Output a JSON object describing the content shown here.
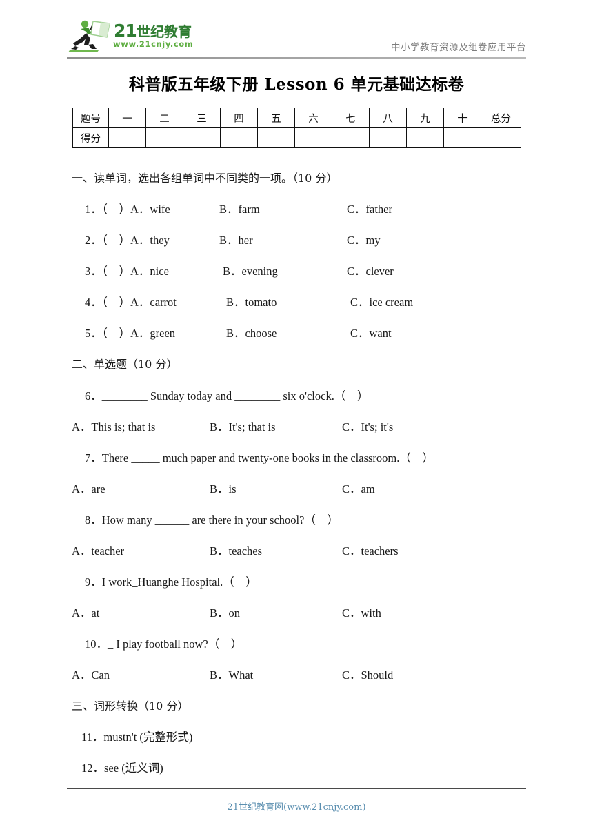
{
  "header": {
    "logo_text_main": "21世纪教育",
    "logo_text_url": "www.21cnjy.com",
    "tagline": "中小学教育资源及组卷应用平台",
    "brand_color": "#2f7d32",
    "tagline_color": "#7d7d7d"
  },
  "title": "科普版五年级下册 Lesson 6 单元基础达标卷",
  "score_table": {
    "row_labels": [
      "题号",
      "得分"
    ],
    "columns": [
      "一",
      "二",
      "三",
      "四",
      "五",
      "六",
      "七",
      "八",
      "九",
      "十",
      "总分"
    ],
    "scores": [
      "",
      "",
      "",
      "",
      "",
      "",
      "",
      "",
      "",
      "",
      ""
    ]
  },
  "sections": [
    {
      "heading": "一、读单词，选出各组单词中不同类的一项。（10 分）",
      "questions": [
        {
          "stem": "1．（　）A．wife",
          "options": [
            "B．farm",
            "C．father"
          ]
        },
        {
          "stem": "2．（　）A．they",
          "options": [
            "B．her",
            "C．my"
          ]
        },
        {
          "stem": "3．（　）A．nice",
          "options": [
            "B．evening",
            "C．clever"
          ]
        },
        {
          "stem": "4．（　）A．carrot",
          "options": [
            "B．tomato",
            "C．ice cream"
          ]
        },
        {
          "stem": "5．（　）A．green",
          "options": [
            "B．choose",
            "C．want"
          ]
        }
      ]
    },
    {
      "heading": "二、单选题（10 分）",
      "questions": [
        {
          "stem": "6．________ Sunday today and ________ six o'clock.（　）",
          "options": [
            "A．This is; that is",
            "B．It's; that is",
            "C．It's; it's"
          ]
        },
        {
          "stem": "7．There _____ much paper and twenty-one books in the classroom.（　）",
          "options": [
            "A．are",
            "B．is",
            "C．am"
          ]
        },
        {
          "stem": "8．How many ______ are there in your school?（　）",
          "options": [
            "A．teacher",
            "B．teaches",
            "C．teachers"
          ]
        },
        {
          "stem": "9．I work_Huanghe Hospital.（　）",
          "options": [
            "A．at",
            "B．on",
            "C．with"
          ]
        },
        {
          "stem": "10．_ I play football now?（　）",
          "options": [
            "A．Can",
            "B．What",
            "C．Should"
          ]
        }
      ]
    },
    {
      "heading": "三、词形转换（10 分）",
      "questions": [
        {
          "stem": "11．mustn't (完整形式) __________",
          "options": []
        },
        {
          "stem": "12．see (近义词) __________",
          "options": []
        }
      ]
    }
  ],
  "footer": {
    "text": "21世纪教育网(www.21cnjy.com)",
    "color": "#5b8fb0"
  }
}
